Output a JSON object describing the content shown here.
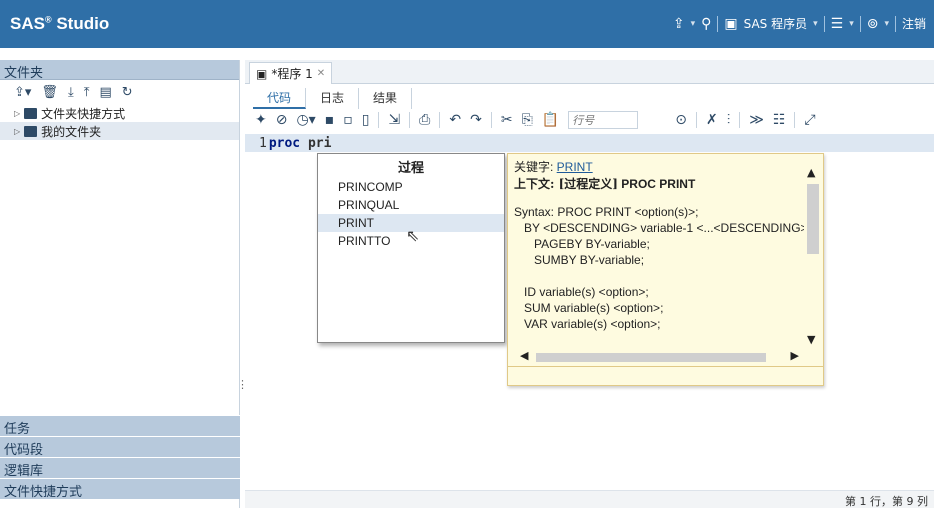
{
  "app": {
    "brand": "SAS",
    "brand_reg": "®",
    "brand_suffix": " Studio",
    "user_label": "SAS 程序员",
    "signout": "注销"
  },
  "left": {
    "header": "文件夹",
    "tree": [
      {
        "label": "文件夹快捷方式"
      },
      {
        "label": "我的文件夹"
      }
    ],
    "accordion": [
      "任务",
      "代码段",
      "逻辑库",
      "文件快捷方式"
    ]
  },
  "editor": {
    "doc_tab": "*程序 1",
    "subtabs": [
      "代码",
      "日志",
      "结果"
    ],
    "line_placeholder": "行号",
    "code_line_number": "1",
    "code_keyword": "proc",
    "code_rest": " pri",
    "status": "第 1 行，第 9 列"
  },
  "autocomplete": {
    "title": "过程",
    "items": [
      "PRINCOMP",
      "PRINQUAL",
      "PRINT",
      "PRINTTO"
    ],
    "selected_index": 2
  },
  "help": {
    "keyword_label": "关键字: ",
    "keyword": "PRINT",
    "context_label": "上下文: ",
    "context_bracket": "[过程定义]",
    "context_value": " PROC PRINT",
    "syntax": "Syntax: PROC PRINT <option(s)>;\n   BY <DESCENDING> variable-1 <...<DESCENDING>\n      PAGEBY BY-variable;\n      SUMBY BY-variable;\n\n   ID variable(s) <option>;\n   SUM variable(s) <option>;\n   VAR variable(s) <option>;"
  },
  "colors": {
    "topbar": "#2f6fa7",
    "panel": "#b7c9dc",
    "selection": "#dde7f2",
    "help_bg": "#fefbe0"
  }
}
